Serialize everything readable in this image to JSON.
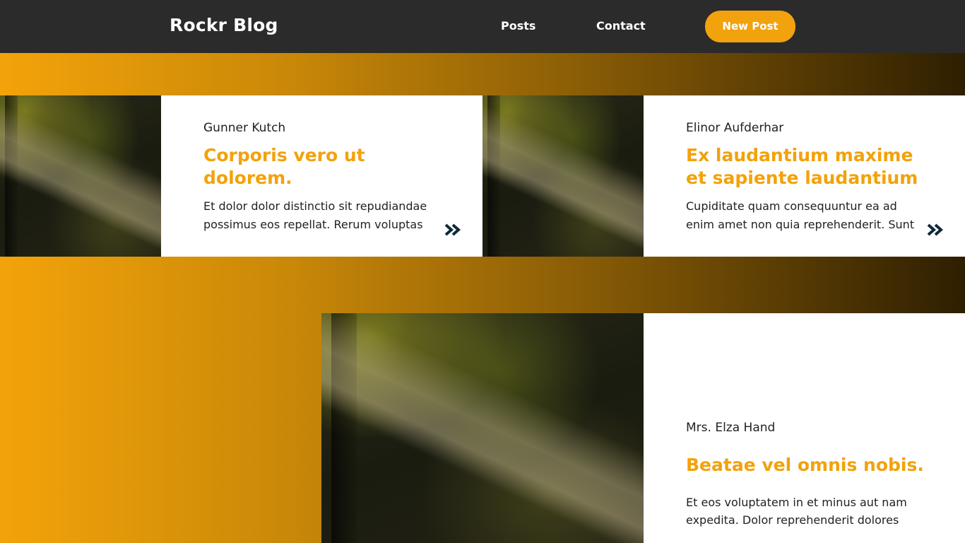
{
  "header": {
    "brand": "Rockr Blog",
    "nav": [
      {
        "label": "Posts"
      },
      {
        "label": "Contact"
      }
    ],
    "new_post_label": "New Post"
  },
  "colors": {
    "accent": "#f2a20c",
    "topbar": "#2b2b2b",
    "gradient_start": "#f3a30a",
    "gradient_end": "#2e1f01",
    "chevron": "#0f2a3a"
  },
  "posts": [
    {
      "author": "Gunner Kutch",
      "title_line1": "Corporis vero ut",
      "title_line2": "dolorem.",
      "excerpt_line1": "Et dolor dolor distinctio sit repudiandae",
      "excerpt_line2": "possimus eos repellat. Rerum voluptas",
      "icon": "chevron-double-right-icon"
    },
    {
      "author": "Elinor Aufderhar",
      "title_line1": "Ex laudantium maxime",
      "title_line2": "et sapiente laudantium",
      "excerpt_line1": "Cupiditate quam consequuntur ea ad",
      "excerpt_line2": "enim amet non quia reprehenderit. Sunt",
      "icon": "chevron-double-right-icon"
    },
    {
      "author": "Mrs. Elza Hand",
      "title_line1": "Beatae vel omnis nobis.",
      "excerpt_line1": "Et eos voluptatem in et minus aut nam",
      "excerpt_line2": "expedita. Dolor reprehenderit dolores"
    }
  ]
}
